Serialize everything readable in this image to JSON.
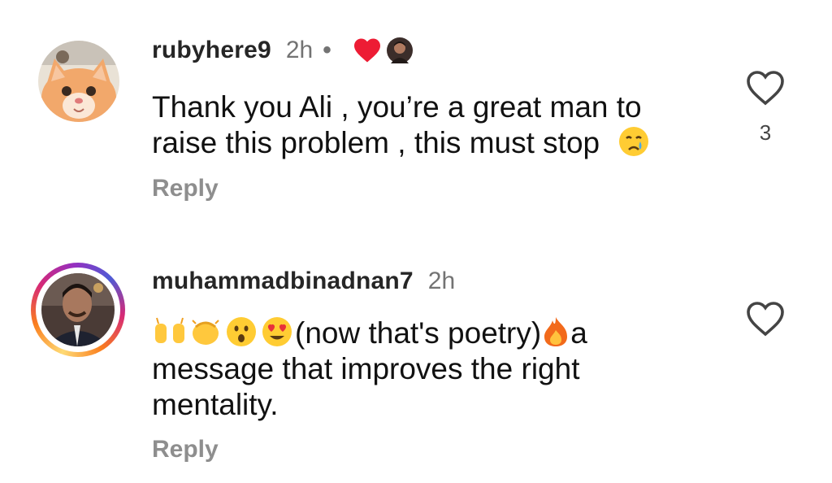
{
  "comments": [
    {
      "username": "rubyhere9",
      "time": "2h",
      "separator": "•",
      "text_line1": "Thank you Ali , you’re a great man to",
      "text_line2": "raise this problem , this must stop",
      "reply_label": "Reply",
      "like_count": "3",
      "liked_by_creator": true,
      "icons": [
        "avatar-cat",
        "red-heart-icon",
        "creator-avatar",
        "crying-face-emoji",
        "heart-outline-icon"
      ]
    },
    {
      "username": "muhammadbinadnan7",
      "time": "2h",
      "text_part1": "(now that's poetry)",
      "text_part2": "a",
      "text_line2": "message that improves the right",
      "text_line3": "mentality.",
      "reply_label": "Reply",
      "icons": [
        "raising-hands-emoji",
        "clapping-hands-emoji",
        "surprised-face-emoji",
        "heart-eyes-emoji",
        "fire-emoji",
        "heart-outline-icon"
      ]
    }
  ],
  "colors": {
    "username": "#262626",
    "muted": "#737373",
    "reply": "#8e8e8e",
    "like_heart": "#ed1c34"
  }
}
